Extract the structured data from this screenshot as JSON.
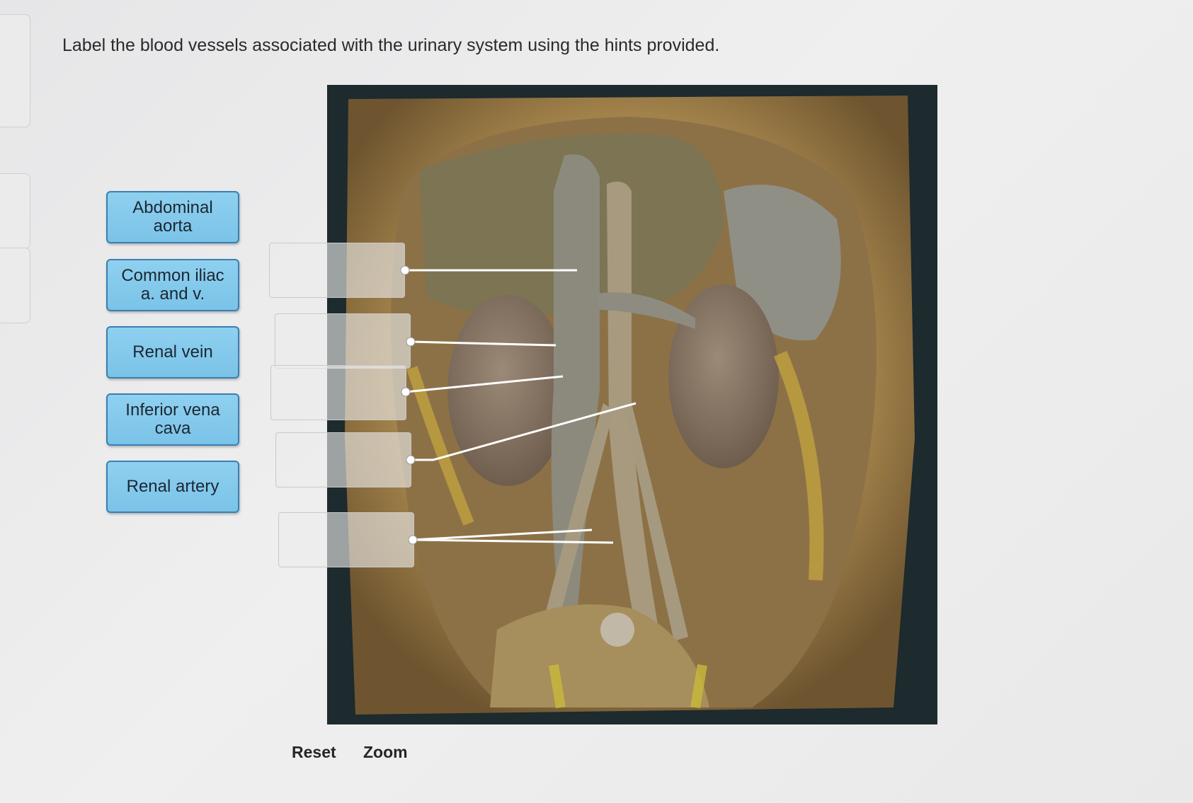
{
  "instruction": "Label the blood vessels associated with the urinary system using the hints provided.",
  "labels": [
    {
      "text": "Abdominal aorta"
    },
    {
      "text": "Common iliac a. and v."
    },
    {
      "text": "Renal vein"
    },
    {
      "text": "Inferior vena cava"
    },
    {
      "text": "Renal artery"
    }
  ],
  "drop_zones": [
    {
      "value": ""
    },
    {
      "value": ""
    },
    {
      "value": ""
    },
    {
      "value": ""
    },
    {
      "value": ""
    }
  ],
  "controls": {
    "reset_label": "Reset",
    "zoom_label": "Zoom"
  },
  "colors": {
    "label_fill": "#7ac3e8",
    "label_border": "#3a7fb0",
    "leader_line": "#ffffff"
  }
}
